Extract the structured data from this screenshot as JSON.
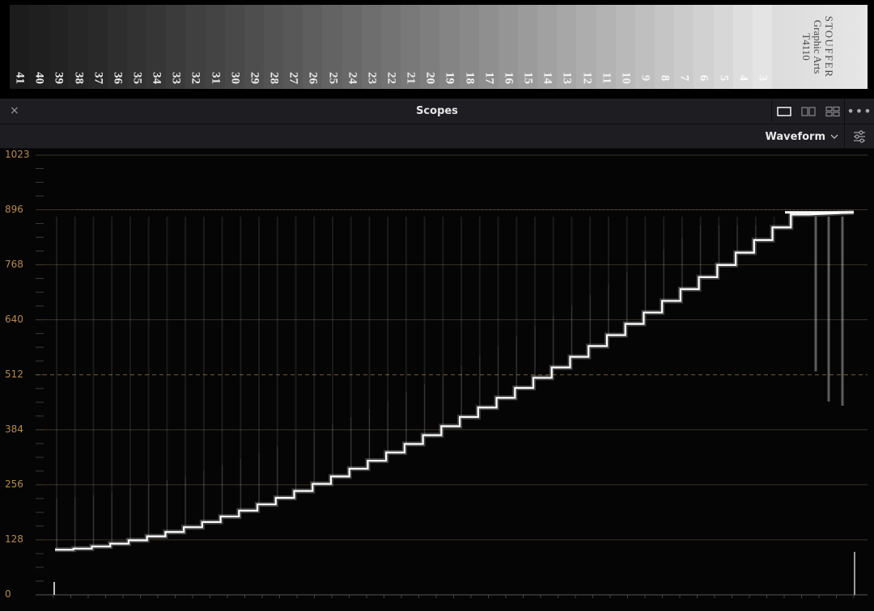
{
  "wedge": {
    "steps": [
      "41",
      "40",
      "39",
      "38",
      "37",
      "36",
      "35",
      "34",
      "33",
      "32",
      "31",
      "30",
      "29",
      "28",
      "27",
      "26",
      "25",
      "24",
      "23",
      "22",
      "21",
      "20",
      "19",
      "18",
      "17",
      "16",
      "15",
      "14",
      "13",
      "12",
      "11",
      "10",
      "9",
      "8",
      "7",
      "6",
      "5",
      "4",
      "3"
    ],
    "brand_lines": [
      "STOUFFER",
      "Graphic Arts",
      "T4110"
    ]
  },
  "panel": {
    "title": "Scopes",
    "close_glyph": "×",
    "more_glyph": "•••",
    "icons": [
      "close-icon",
      "single-view-icon",
      "dual-view-icon",
      "quad-view-icon",
      "more-icon",
      "chevron-down-icon",
      "sliders-icon"
    ],
    "scope_type": "Waveform"
  },
  "scope": {
    "y_labels": [
      "1023",
      "896",
      "768",
      "640",
      "512",
      "384",
      "256",
      "128",
      "0"
    ],
    "y_values": [
      1023,
      896,
      768,
      640,
      512,
      384,
      256,
      128,
      0
    ],
    "reference_dashed": 512,
    "colors": {
      "label": "#b58a4e",
      "grid": "#3a3326",
      "trace": "#ffffff",
      "background": "#050505"
    }
  }
}
